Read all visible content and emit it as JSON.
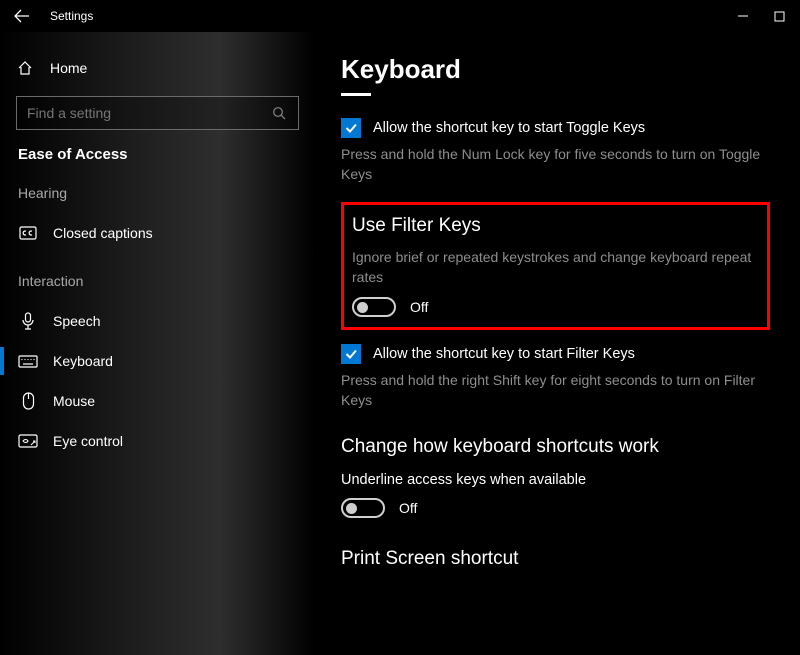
{
  "window": {
    "title": "Settings"
  },
  "sidebar": {
    "home": "Home",
    "search_placeholder": "Find a setting",
    "section": "Ease of Access",
    "cat_hearing": "Hearing",
    "cat_interaction": "Interaction",
    "items": {
      "closed_captions": "Closed captions",
      "speech": "Speech",
      "keyboard": "Keyboard",
      "mouse": "Mouse",
      "eye_control": "Eye control"
    }
  },
  "content": {
    "page_title": "Keyboard",
    "toggle_keys_check": "Allow the shortcut key to start Toggle Keys",
    "toggle_keys_desc": "Press and hold the Num Lock key for five seconds to turn on Toggle Keys",
    "filter": {
      "head": "Use Filter Keys",
      "desc": "Ignore brief or repeated keystrokes and change keyboard repeat rates",
      "state": "Off"
    },
    "filter_check": "Allow the shortcut key to start Filter Keys",
    "filter_check_desc": "Press and hold the right Shift key for eight seconds to turn on Filter Keys",
    "shortcuts_head": "Change how keyboard shortcuts work",
    "underline_label": "Underline access keys when available",
    "underline_state": "Off",
    "printscreen_head": "Print Screen shortcut"
  }
}
